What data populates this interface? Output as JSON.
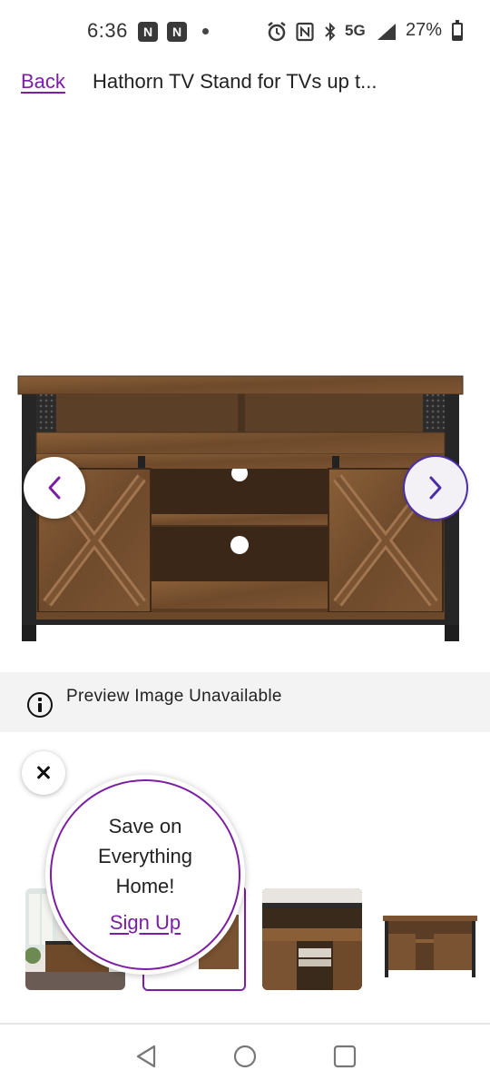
{
  "status_bar": {
    "time": "6:36",
    "network": "5G",
    "battery": "27%",
    "battery_level": 0.27
  },
  "header": {
    "back_label": "Back",
    "title": "Hathorn TV Stand for TVs up t..."
  },
  "product": {
    "image_icon": "tv-stand-image",
    "prev_icon": "chevron-left-icon",
    "next_icon": "chevron-right-icon"
  },
  "preview": {
    "message": "Preview Image Unavailable"
  },
  "promo": {
    "line1": "Save on",
    "line2": "Everything",
    "line3": "Home!",
    "link_label": "Sign Up"
  },
  "thumbnails": [
    {
      "name": "room-scene"
    },
    {
      "name": "front-view",
      "selected": true
    },
    {
      "name": "detail-shelves"
    },
    {
      "name": "product-angle"
    }
  ],
  "colors": {
    "accent": "#7b1fa2",
    "selected_ring": "#4b2fa8",
    "wood": "#7a5432",
    "frame": "#2b2b2b"
  }
}
